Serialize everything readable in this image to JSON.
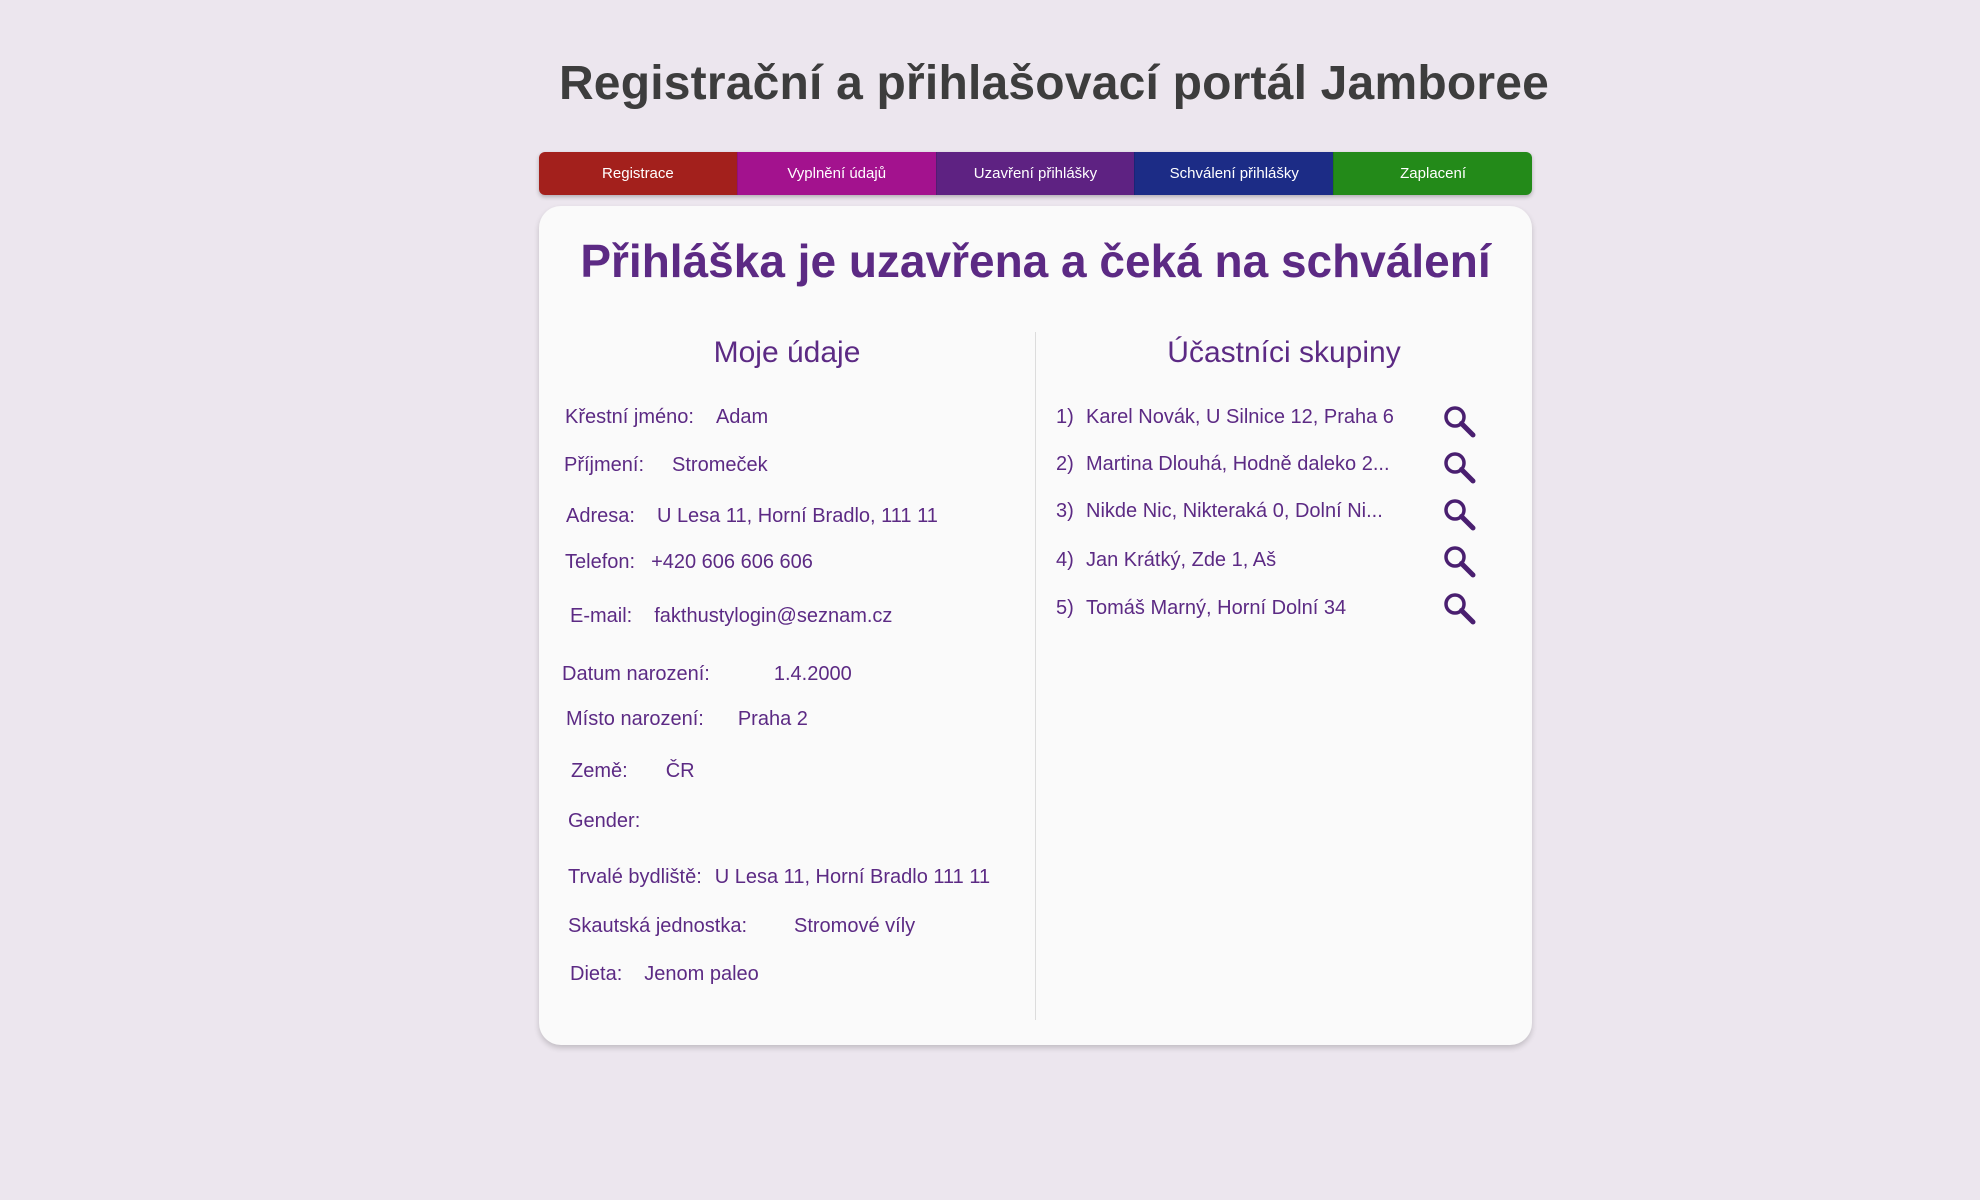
{
  "portal": {
    "title": "Registrační a přihlašovací portál Jamboree"
  },
  "steps": [
    {
      "label": "Registrace",
      "color": "#a3201c"
    },
    {
      "label": "Vyplnění údajů",
      "color": "#a3128e"
    },
    {
      "label": "Uzavření přihlášky",
      "color": "#5e2282"
    },
    {
      "label": "Schválení přihlášky",
      "color": "#1c2c86"
    },
    {
      "label": "Zaplacení",
      "color": "#238a19"
    }
  ],
  "status": {
    "heading": "Přihláška je uzavřena a čeká na schválení"
  },
  "my_data": {
    "heading": "Moje údaje",
    "fields": [
      {
        "label": "Křestní jméno:",
        "value": "Adam"
      },
      {
        "label": "Příjmení:",
        "value": "Stromeček"
      },
      {
        "label": "Adresa:",
        "value": "U Lesa 11, Horní Bradlo, 111 11"
      },
      {
        "label": "Telefon:",
        "value": "+420 606 606 606"
      },
      {
        "label": "E-mail:",
        "value": "fakthustylogin@seznam.cz"
      },
      {
        "label": "Datum narození:",
        "value": "1.4.2000"
      },
      {
        "label": "Místo narození:",
        "value": "Praha 2"
      },
      {
        "label": "Země:",
        "value": "ČR"
      },
      {
        "label": "Gender:",
        "value": ""
      },
      {
        "label": "Trvalé bydliště:",
        "value": "U Lesa 11, Horní Bradlo 111 11"
      },
      {
        "label": "Skautská jednostka:",
        "value": "Stromové víly"
      },
      {
        "label": "Dieta:",
        "value": "Jenom paleo"
      }
    ]
  },
  "group": {
    "heading": "Účastníci skupiny",
    "members": [
      {
        "number": "1)",
        "text": "Karel Novák, U Silnice 12, Praha 6",
        "icon": "search-icon"
      },
      {
        "number": "2)",
        "text": "Martina Dlouhá, Hodně daleko 2...",
        "icon": "search-icon"
      },
      {
        "number": "3)",
        "text": "Nikde Nic, Nikteraká 0, Dolní Ni...",
        "icon": "search-icon"
      },
      {
        "number": "4)",
        "text": "Jan Krátký, Zde 1, Aš",
        "icon": "search-icon"
      },
      {
        "number": "5)",
        "text": "Tomáš Marný, Horní Dolní 34",
        "icon": "search-icon"
      }
    ]
  },
  "colors": {
    "background": "#ece6ee",
    "accent": "#5c2a84",
    "card": "#fafafa",
    "title": "#3d3d3d"
  }
}
